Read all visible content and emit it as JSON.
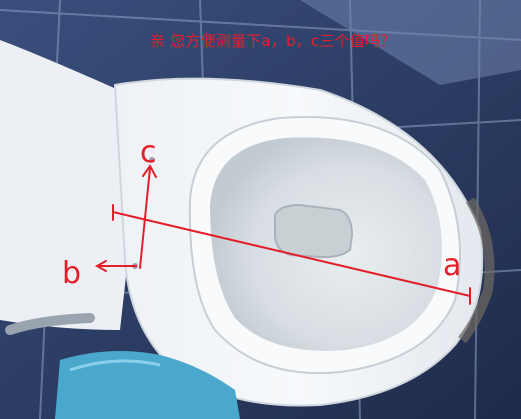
{
  "annotation": {
    "caption": "亲  您方便测量下a，b，c三个值吗？",
    "label_a": "a",
    "label_b": "b",
    "label_c": "c",
    "color": "#e3202a"
  },
  "colors": {
    "tile": "#2b3b62",
    "porcelain": "#f3f5f8",
    "bowl_water": "#dfe6e8",
    "bucket": "#4aa8cc"
  }
}
